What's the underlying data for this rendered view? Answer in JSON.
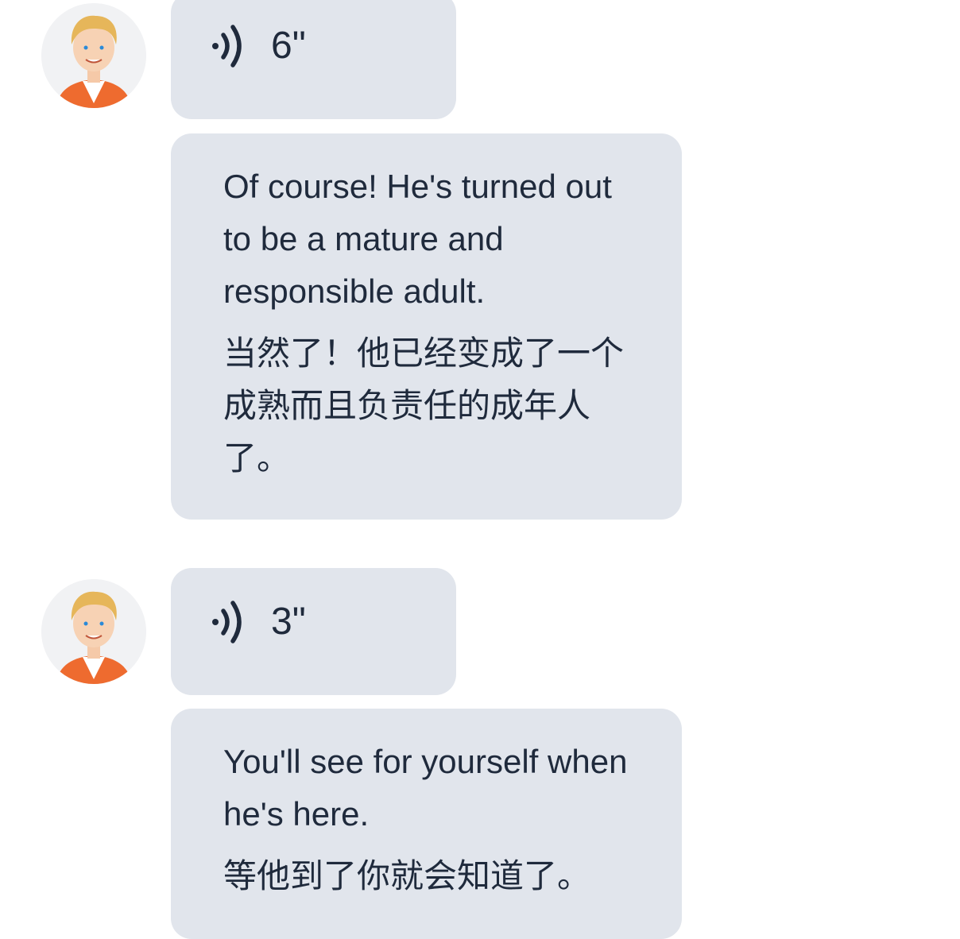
{
  "messages": [
    {
      "audio": {
        "duration": "6\"",
        "icon": "speaker-waves-icon"
      },
      "text": {
        "english": "Of course! He's turned out to be a mature and responsible adult.",
        "chinese": "当然了！他已经变成了一个成熟而且负责任的成年人了。"
      }
    },
    {
      "audio": {
        "duration": "3\"",
        "icon": "speaker-waves-icon"
      },
      "text": {
        "english": "You'll see for yourself when he's here.",
        "chinese": "等他到了你就会知道了。"
      }
    }
  ],
  "colors": {
    "bubble": "#e1e5ec",
    "text": "#1f2a3c",
    "avatar_jacket": "#ee6b2f",
    "avatar_hair": "#e6b65a"
  }
}
